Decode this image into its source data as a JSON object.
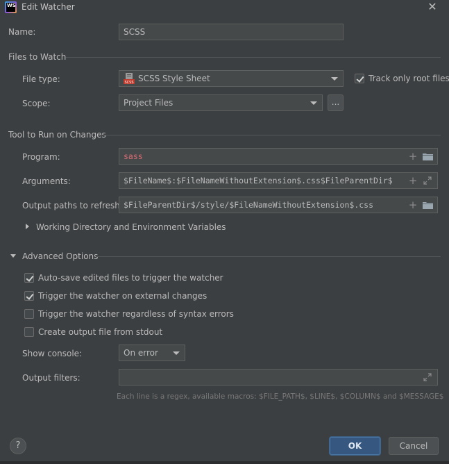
{
  "window": {
    "app_icon": "webstorm-logo-icon",
    "app_icon_text": "WS",
    "title": "Edit Watcher"
  },
  "name": {
    "label": "Name:",
    "value": "SCSS"
  },
  "files_to_watch": {
    "section_title": "Files to Watch",
    "file_type": {
      "label": "File type:",
      "value": "SCSS Style Sheet",
      "icon": "scss-file-icon"
    },
    "track_root": {
      "label": "Track only root files",
      "checked": true
    },
    "scope": {
      "label": "Scope:",
      "value": "Project Files",
      "browse_label": "..."
    }
  },
  "tool": {
    "section_title": "Tool to Run on Changes",
    "program": {
      "label": "Program:",
      "value": "sass",
      "value_color": "#e06c75"
    },
    "arguments": {
      "label": "Arguments:",
      "value": "$FileName$:$FileNameWithoutExtension$.css$FileParentDir$"
    },
    "output_paths": {
      "label": "Output paths to refresh:",
      "value": "$FileParentDir$/style/$FileNameWithoutExtension$.css"
    },
    "working_dir": {
      "label": "Working Directory and Environment Variables",
      "expanded": false
    }
  },
  "advanced": {
    "section_title": "Advanced Options",
    "expanded": true,
    "options": [
      {
        "label": "Auto-save edited files to trigger the watcher",
        "checked": true
      },
      {
        "label": "Trigger the watcher on external changes",
        "checked": true
      },
      {
        "label": "Trigger the watcher regardless of syntax errors",
        "checked": false
      },
      {
        "label": "Create output file from stdout",
        "checked": false
      }
    ],
    "show_console": {
      "label": "Show console:",
      "value": "On error"
    },
    "output_filters": {
      "label": "Output filters:",
      "value": "",
      "hint": "Each line is a regex, available macros: $FILE_PATH$, $LINE$, $COLUMN$ and $MESSAGE$"
    }
  },
  "footer": {
    "help_label": "?",
    "ok_label": "OK",
    "cancel_label": "Cancel"
  },
  "colors": {
    "background": "#3c3f41",
    "field_background": "#45494a",
    "primary_button": "#365880",
    "program_text": "#e06c75"
  }
}
